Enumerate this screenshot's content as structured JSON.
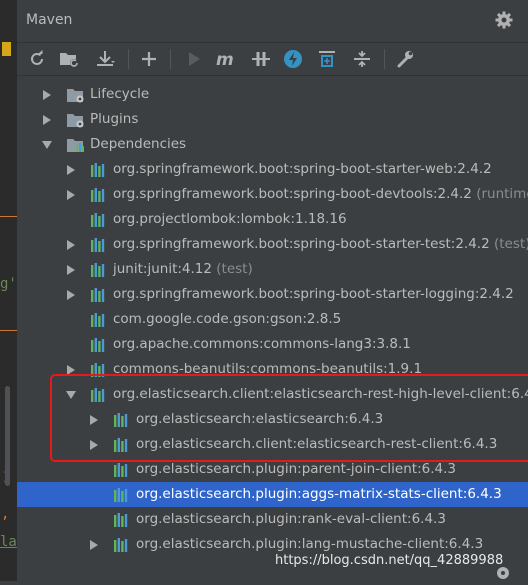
{
  "panel": {
    "title": "Maven"
  },
  "toolbar": {
    "buttons": [
      {
        "name": "reimport-icon"
      },
      {
        "name": "generate-sources-icon"
      },
      {
        "name": "download-icon"
      },
      {
        "name": "add-icon"
      },
      {
        "name": "run-icon"
      },
      {
        "name": "execute-goal-icon"
      },
      {
        "name": "toggle-offline-icon"
      },
      {
        "name": "skip-tests-icon"
      },
      {
        "name": "show-dependencies-icon"
      },
      {
        "name": "collapse-all-icon"
      },
      {
        "name": "settings-wrench-icon"
      }
    ]
  },
  "tree": {
    "lifecycle": "Lifecycle",
    "plugins": "Plugins",
    "dependencies": "Dependencies",
    "items": [
      {
        "label": "org.springframework.boot:spring-boot-starter-web:2.4.2",
        "suffix": ""
      },
      {
        "label": "org.springframework.boot:spring-boot-devtools:2.4.2",
        "suffix": "(runtime)"
      },
      {
        "label": "org.projectlombok:lombok:1.18.16",
        "suffix": ""
      },
      {
        "label": "org.springframework.boot:spring-boot-starter-test:2.4.2",
        "suffix": "(test)"
      },
      {
        "label": "junit:junit:4.12",
        "suffix": "(test)"
      },
      {
        "label": "org.springframework.boot:spring-boot-starter-logging:2.4.2",
        "suffix": ""
      },
      {
        "label": "com.google.code.gson:gson:2.8.5",
        "suffix": ""
      },
      {
        "label": "org.apache.commons:commons-lang3:3.8.1",
        "suffix": ""
      },
      {
        "label": "commons-beanutils:commons-beanutils:1.9.1",
        "suffix": ""
      },
      {
        "label": "org.elasticsearch.client:elasticsearch-rest-high-level-client:6.4",
        "suffix": ""
      }
    ],
    "es_children": [
      {
        "label": "org.elasticsearch:elasticsearch:6.4.3"
      },
      {
        "label": "org.elasticsearch.client:elasticsearch-rest-client:6.4.3"
      },
      {
        "label": "org.elasticsearch.plugin:parent-join-client:6.4.3"
      },
      {
        "label": "org.elasticsearch.plugin:aggs-matrix-stats-client:6.4.3"
      },
      {
        "label": "org.elasticsearch.plugin:rank-eval-client:6.4.3"
      },
      {
        "label": "org.elasticsearch.plugin:lang-mustache-client:6.4.3"
      }
    ]
  },
  "editor_fragments": {
    "a": "g'",
    "b": "I",
    "c": ",",
    "d": "la"
  },
  "watermark": "https://blog.csdn.net/qq_42889988",
  "colors": {
    "selection": "#2f65ca",
    "highlight_box": "#e8191a",
    "dep_icon_green": "#5fb55c",
    "dep_icon_blue": "#4a9ad8"
  }
}
